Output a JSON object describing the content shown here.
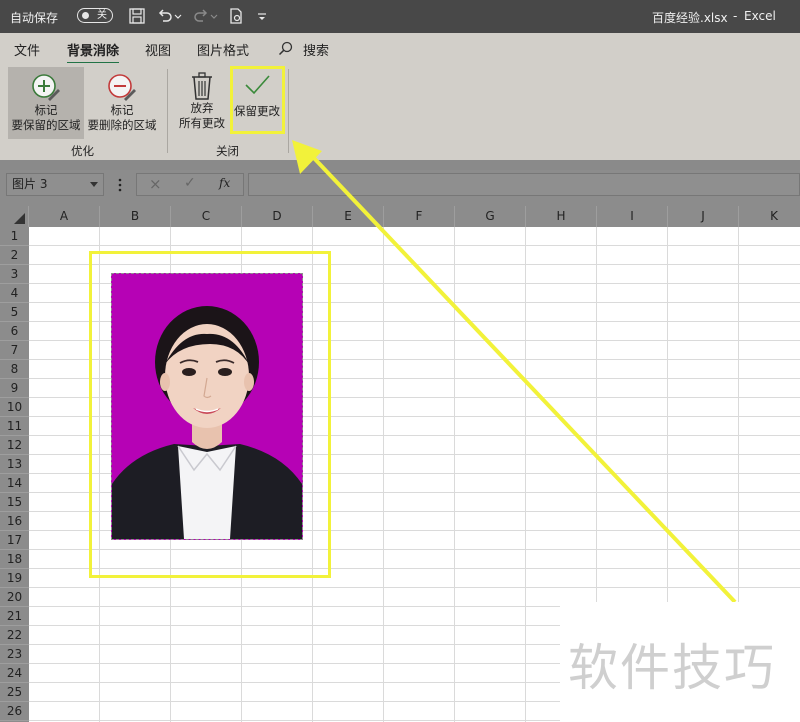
{
  "titlebar": {
    "autosave_label": "自动保存",
    "autosave_state": "关",
    "file_title": "百度经验.xlsx",
    "separator": "-",
    "app_name": "Excel"
  },
  "tabs": [
    {
      "label": "文件"
    },
    {
      "label": "背景消除"
    },
    {
      "label": "视图"
    },
    {
      "label": "图片格式"
    }
  ],
  "search_label": "搜索",
  "ribbon": {
    "mark_keep_line1": "标记",
    "mark_keep_line2": "要保留的区域",
    "mark_remove_line1": "标记",
    "mark_remove_line2": "要删除的区域",
    "group_refine": "优化",
    "discard_line1": "放弃",
    "discard_line2": "所有更改",
    "keep_changes": "保留更改",
    "group_close": "关闭"
  },
  "namebox_value": "图片 3",
  "formula_icons": {
    "cancel": "×",
    "enter": "✓",
    "fx": "fx"
  },
  "columns": [
    "A",
    "B",
    "C",
    "D",
    "E",
    "F",
    "G",
    "H",
    "I",
    "J",
    "K"
  ],
  "rows": [
    "1",
    "2",
    "3",
    "4",
    "5",
    "6",
    "7",
    "8",
    "9",
    "10",
    "11",
    "12",
    "13",
    "14",
    "15",
    "16",
    "17",
    "18",
    "19",
    "20",
    "21",
    "22",
    "23",
    "24",
    "25",
    "26"
  ],
  "watermark": "软件技巧",
  "colors": {
    "highlight": "#f2f23a",
    "photo_background": "#b602b5",
    "accent": "#217346"
  }
}
